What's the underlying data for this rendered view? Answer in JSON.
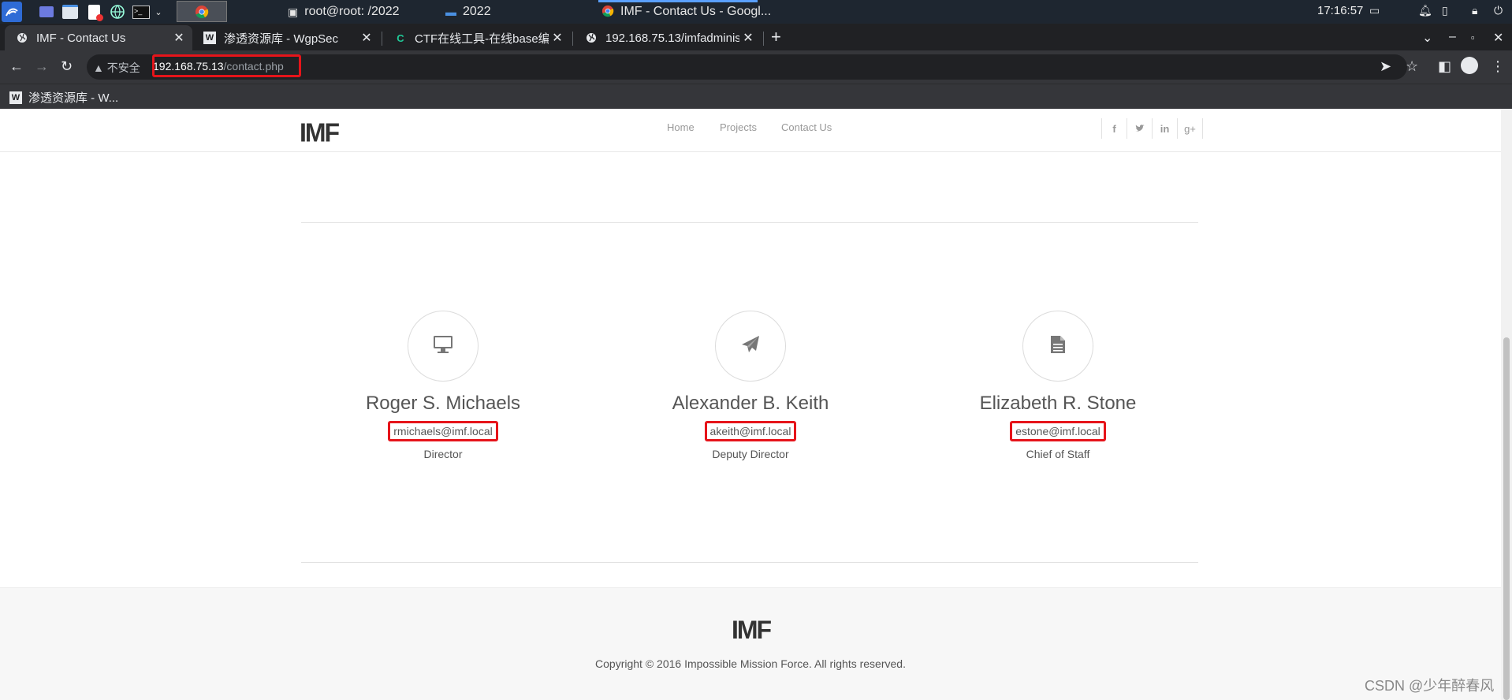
{
  "taskbar": {
    "windows": [
      "root@root: /2022",
      "2022",
      "IMF - Contact Us - Googl..."
    ],
    "clock": "17:16:57"
  },
  "browser": {
    "tabs": [
      {
        "title": "IMF - Contact Us",
        "active": true
      },
      {
        "title": "渗透资源库 - WgpSec",
        "active": false
      },
      {
        "title": "CTF在线工具-在线base编",
        "active": false
      },
      {
        "title": "192.168.75.13/imfadminis",
        "active": false
      }
    ],
    "insecure_label": "不安全",
    "url_host": "192.168.75.13",
    "url_path": "/contact.php",
    "bookmark": "渗透资源库 - W..."
  },
  "site": {
    "logo": "IMF",
    "nav": [
      "Home",
      "Projects",
      "Contact Us"
    ],
    "social_icons": [
      "facebook-icon",
      "twitter-icon",
      "linkedin-icon",
      "google-plus-icon"
    ]
  },
  "contacts": [
    {
      "icon": "desktop-icon",
      "name": "Roger S. Michaels",
      "email": "rmichaels@imf.local",
      "role": "Director"
    },
    {
      "icon": "paper-plane-icon",
      "name": "Alexander B. Keith",
      "email": "akeith@imf.local",
      "role": "Deputy Director"
    },
    {
      "icon": "document-icon",
      "name": "Elizabeth R. Stone",
      "email": "estone@imf.local",
      "role": "Chief of Staff"
    }
  ],
  "footer": {
    "logo": "IMF",
    "copyright": "Copyright © 2016 Impossible Mission Force. All rights reserved."
  },
  "watermark": "CSDN @少年醉春风",
  "colors": {
    "highlight": "#e6141a",
    "active_indicator": "#5aa0ff"
  }
}
